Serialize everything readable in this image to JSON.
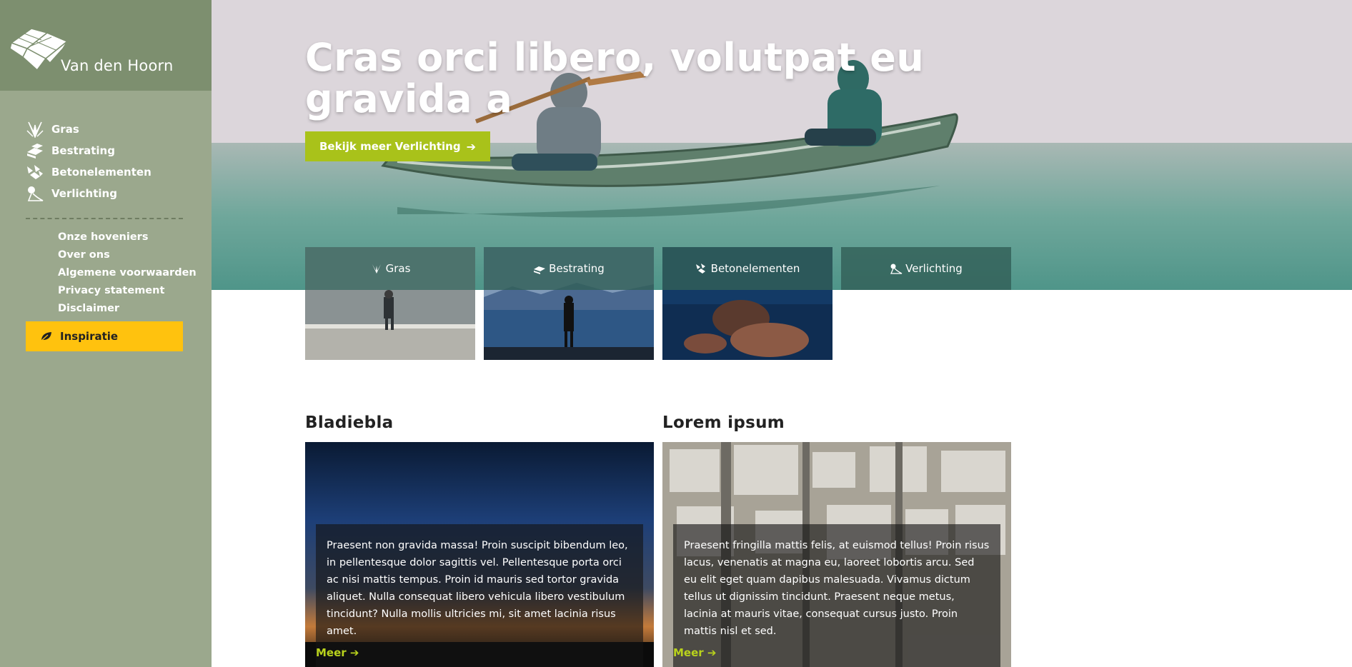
{
  "brand": {
    "name": "Van den Hoorn"
  },
  "sidebar": {
    "main_items": [
      {
        "label": "Gras",
        "icon": "grass-icon"
      },
      {
        "label": "Bestrating",
        "icon": "paving-icon"
      },
      {
        "label": "Betonelementen",
        "icon": "concrete-icon"
      },
      {
        "label": "Verlichting",
        "icon": "lamp-icon"
      }
    ],
    "sub_items": [
      {
        "label": "Onze hoveniers"
      },
      {
        "label": "Over ons"
      },
      {
        "label": "Algemene voorwaarden"
      },
      {
        "label": "Privacy statement"
      },
      {
        "label": "Disclaimer"
      }
    ],
    "cta": {
      "label": "Inspiratie",
      "icon": "leaf-icon"
    }
  },
  "hero": {
    "title": "Cras orci libero, volutpat eu gravida a",
    "button_label": "Bekijk meer Verlichting",
    "button_icon": "arrow-right-icon"
  },
  "tiles": [
    {
      "label": "Gras",
      "icon": "grass-icon"
    },
    {
      "label": "Bestrating",
      "icon": "paving-icon"
    },
    {
      "label": "Betonelementen",
      "icon": "concrete-icon"
    },
    {
      "label": "Verlichting",
      "icon": "lamp-icon"
    }
  ],
  "articles": [
    {
      "title": "Bladiebla",
      "body": "Praesent non gravida massa! Proin suscipit bibendum leo, in pellentesque dolor sagittis vel. Pellentesque porta orci ac nisi mattis tempus. Proin id mauris sed tortor gravida aliquet. Nulla consequat libero vehicula libero vestibulum tincidunt? Nulla mollis ultricies mi, sit amet lacinia risus amet.",
      "more_label": "Meer"
    },
    {
      "title": "Lorem ipsum",
      "body": "Praesent fringilla mattis felis, at euismod tellus! Proin risus lacus, venenatis at magna eu, laoreet lobortis arcu. Sed eu elit eget quam dapibus malesuada. Vivamus dictum tellus ut dignissim tincidunt. Praesent neque metus, lacinia at mauris vitae, consequat cursus justo. Proin mattis nisl et sed.",
      "more_label": "Meer"
    }
  ],
  "colors": {
    "sidebar_bg": "#9ba88d",
    "logo_bg": "#7d8f6f",
    "cta_yellow": "#ffc20e",
    "hero_button_green": "#a9c21a",
    "tile_band": "#325f58",
    "link_green": "#b9d21c"
  }
}
